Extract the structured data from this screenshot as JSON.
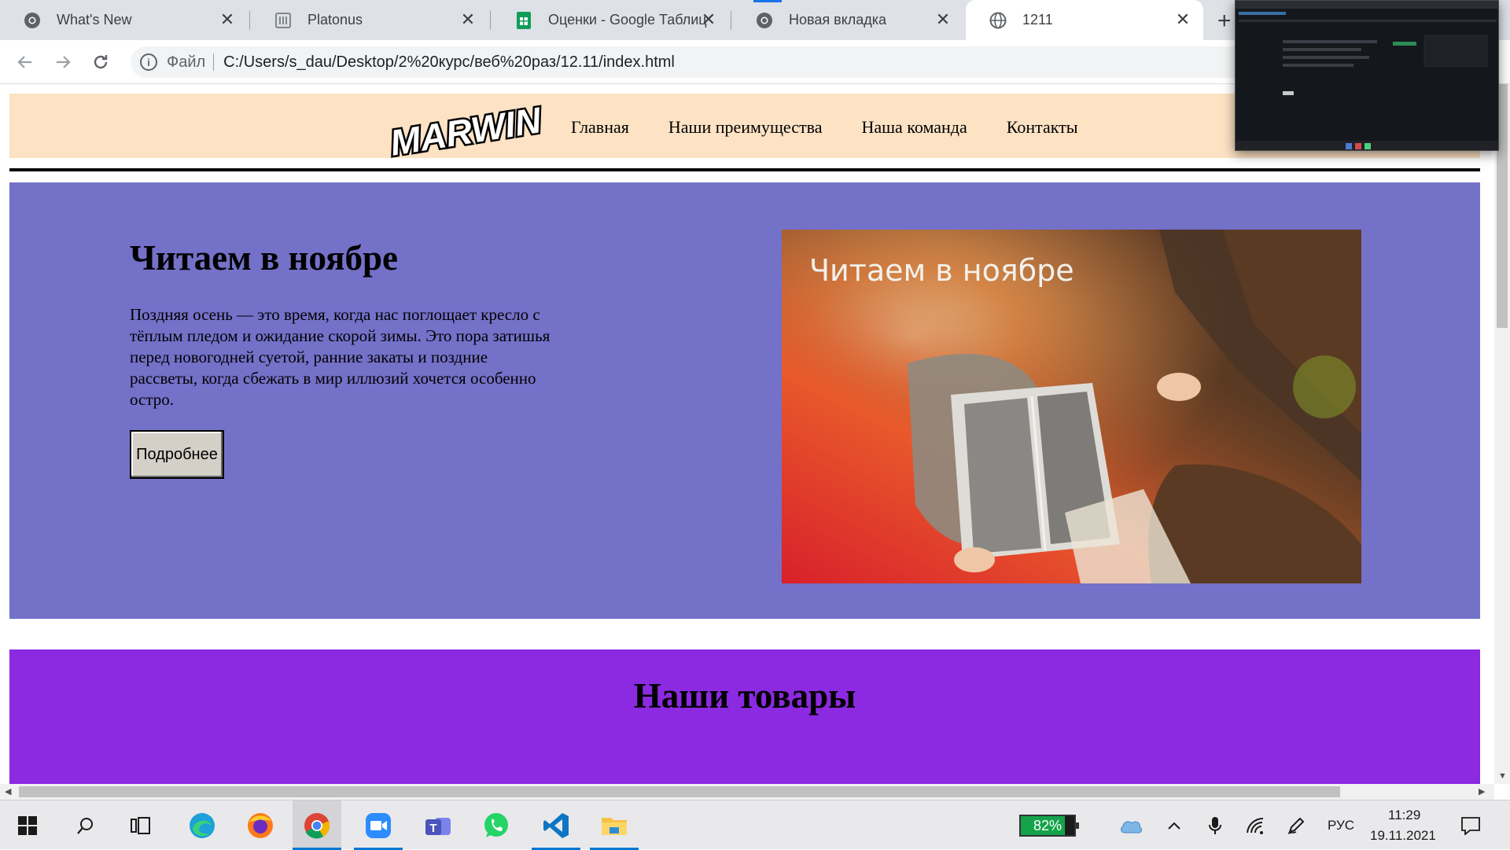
{
  "browser": {
    "tabs": [
      {
        "title": "What's New",
        "icon": "chrome-icon"
      },
      {
        "title": "Platonus",
        "icon": "platonus-icon"
      },
      {
        "title": "Оценки - Google Таблиц",
        "icon": "google-sheets-icon"
      },
      {
        "title": "Новая вкладка",
        "icon": "chrome-icon"
      },
      {
        "title": "1211",
        "icon": "globe-icon",
        "active": true
      }
    ],
    "address": {
      "scheme_label": "Файл",
      "url": "C:/Users/s_dau/Desktop/2%20курс/веб%20раз/12.11/index.html"
    }
  },
  "page": {
    "logo_text": "MARWIN",
    "nav": [
      "Главная",
      "Наши преимущества",
      "Наша команда",
      "Контакты"
    ],
    "hero": {
      "title": "Читаем в ноябре",
      "text": "Поздняя осень — это время, когда нас поглощает кресло с тёплым пледом и ожидание скорой зимы. Это пора затишья перед новогодней суетой, ранние закаты и поздние рассветы, когда сбежать в мир иллюзий хочется особенно остро.",
      "button": "Подробнее",
      "image_caption": "Читаем в ноябре"
    },
    "goods_title": "Наши товары"
  },
  "taskbar": {
    "battery_percent": 82,
    "battery_label": "82%",
    "language": "РУС",
    "time": "11:29",
    "date": "19.11.2021"
  },
  "colors": {
    "header_bg": "#fde2c4",
    "hero_bg": "#7471c9",
    "goods_bg": "#8b2ae0"
  }
}
